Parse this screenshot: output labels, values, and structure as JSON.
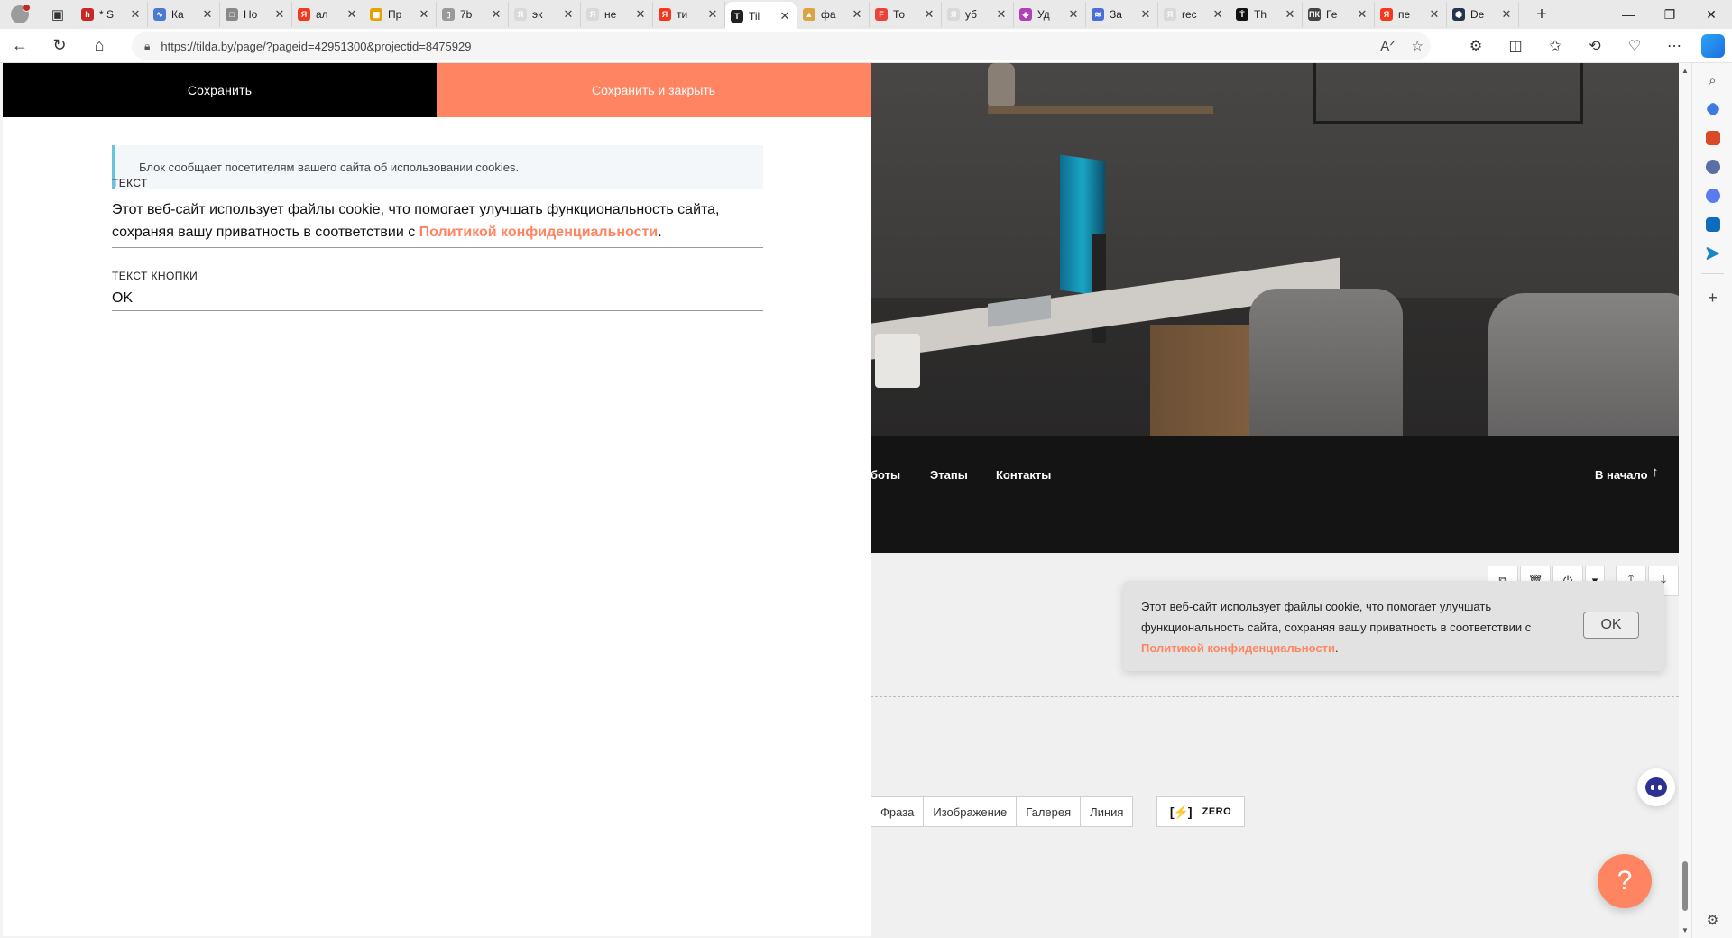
{
  "browser": {
    "tabs": [
      {
        "title": "* S",
        "color": "#c62828",
        "glyph": "h"
      },
      {
        "title": "Ка",
        "color": "#4a7bd0",
        "glyph": "∿"
      },
      {
        "title": "Но",
        "color": "#888888",
        "glyph": "□"
      },
      {
        "title": "ал",
        "color": "#f5371e",
        "glyph": "Я"
      },
      {
        "title": "Пр",
        "color": "#e5a100",
        "glyph": "▦"
      },
      {
        "title": "7b",
        "color": "#999999",
        "glyph": "▯"
      },
      {
        "title": "эк",
        "color": "#d9d9d9",
        "glyph": "Я"
      },
      {
        "title": "не",
        "color": "#d9d9d9",
        "glyph": "Я"
      },
      {
        "title": "ти",
        "color": "#f5371e",
        "glyph": "Я"
      },
      {
        "title": "Til",
        "color": "#222222",
        "glyph": "T"
      },
      {
        "title": "фа",
        "color": "#d9a441",
        "glyph": "▲"
      },
      {
        "title": "То",
        "color": "#e8443a",
        "glyph": "F"
      },
      {
        "title": "уб",
        "color": "#d9d9d9",
        "glyph": "Я"
      },
      {
        "title": "Уд",
        "color": "#b03fb8",
        "glyph": "◈"
      },
      {
        "title": "За",
        "color": "#4a6fd8",
        "glyph": "≋"
      },
      {
        "title": "rec",
        "color": "#d9d9d9",
        "glyph": "Я"
      },
      {
        "title": "Th",
        "color": "#111111",
        "glyph": "Ṫ"
      },
      {
        "title": "Ге",
        "color": "#444444",
        "glyph": "ПК"
      },
      {
        "title": "пе",
        "color": "#f5371e",
        "glyph": "Я"
      },
      {
        "title": "De",
        "color": "#24344d",
        "glyph": "⬢"
      }
    ],
    "active_tab_index": 9,
    "url": "https://tilda.by/page/?pageid=42951300&projectid=8475929",
    "accent": "#ff8562"
  },
  "editor": {
    "save_label": "Сохранить",
    "save_close_label": "Сохранить и закрыть",
    "info": "Блок сообщает посетителям вашего сайта об использовании cookies.",
    "text_label": "ТЕКСТ",
    "text_value_before": "Этот веб-сайт использует файлы cookie, что помогает улучшать функциональность сайта, сохраняя вашу приватность в соответствии с ",
    "text_link": "Политикой конфиденциальности",
    "text_value_after": ".",
    "button_label": "ТЕКСТ КНОПКИ",
    "button_value": "OK"
  },
  "preview": {
    "menu": {
      "item_1": "боты",
      "item_2": "Этапы",
      "item_3": "Контакты",
      "to_top": "В начало",
      "to_top_arrow": "↑"
    },
    "block_tools": [
      "copy-icon",
      "trash-icon",
      "power-icon",
      "chevron-down-icon",
      "arrow-up-icon",
      "arrow-down-icon"
    ],
    "cookie": {
      "text_before": "Этот веб-сайт использует файлы cookie, что помогает улучшать функциональность сайта, сохраняя вашу приватность в соответствии с ",
      "link": "Политикой конфиденциальности",
      "text_after": ".",
      "ok": "OK"
    },
    "library": [
      "Фраза",
      "Изображение",
      "Галерея",
      "Линия"
    ],
    "zero_label": "ZERO",
    "help_glyph": "?"
  }
}
